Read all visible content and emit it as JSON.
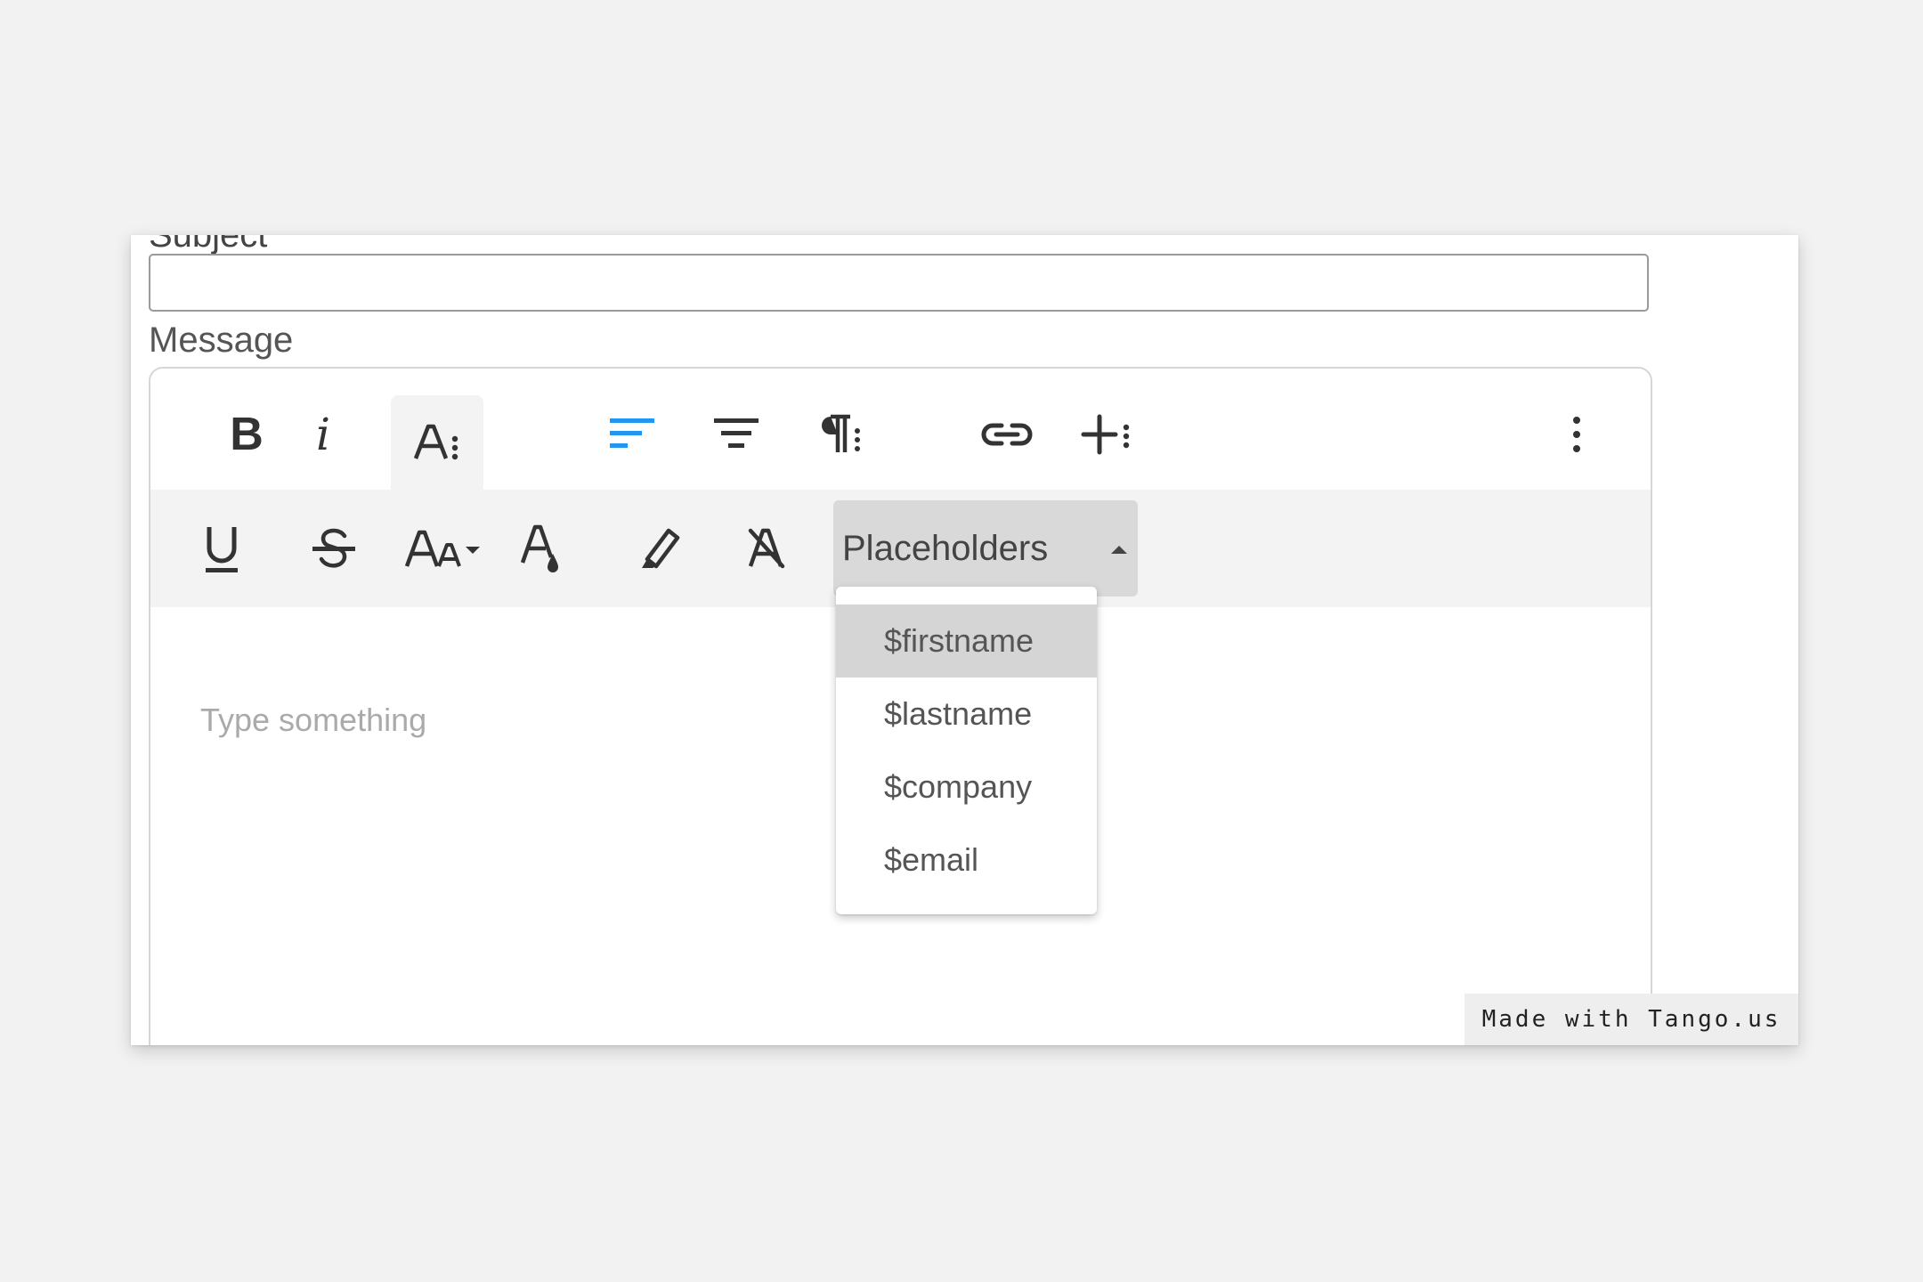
{
  "form": {
    "subject_label": "Subject",
    "subject_value": "",
    "message_label": "Message"
  },
  "toolbar": {
    "row1": [
      {
        "name": "bold-icon",
        "glyph": "B"
      },
      {
        "name": "italic-icon",
        "glyph": "i"
      },
      {
        "name": "text-style-more-icon",
        "glyph": "A⁝",
        "active": true
      },
      {
        "name": "align-left-icon"
      },
      {
        "name": "align-center-icon"
      },
      {
        "name": "paragraph-more-icon"
      },
      {
        "name": "link-icon"
      },
      {
        "name": "insert-more-icon"
      },
      {
        "name": "more-vertical-icon"
      }
    ],
    "row2": [
      {
        "name": "underline-icon"
      },
      {
        "name": "strikethrough-icon"
      },
      {
        "name": "font-size-icon"
      },
      {
        "name": "text-color-icon"
      },
      {
        "name": "highlight-icon"
      },
      {
        "name": "clear-formatting-icon"
      }
    ],
    "accent_color": "#2196f3",
    "placeholders_label": "Placeholders"
  },
  "editor": {
    "placeholder": "Type something"
  },
  "placeholders_dropdown": {
    "items": [
      "$firstname",
      "$lastname",
      "$company",
      "$email"
    ],
    "selected_index": 0
  },
  "watermark": "Made with Tango.us"
}
